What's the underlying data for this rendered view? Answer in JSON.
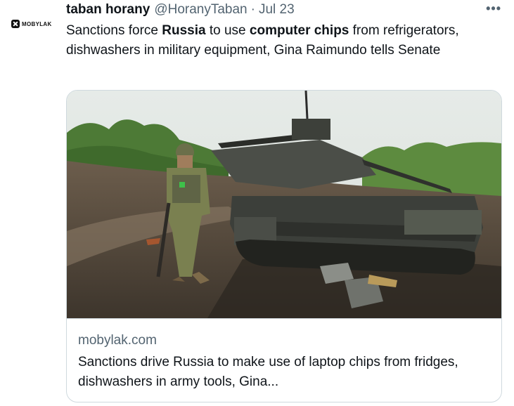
{
  "source_logo": {
    "text": "MOBYLAK",
    "icon": "mobylak-x-logo"
  },
  "tweet": {
    "display_name": "taban horany",
    "handle": "@HoranyTaban",
    "separator": "·",
    "date": "Jul 23",
    "more_icon": "more-horizontal-icon",
    "text_parts": {
      "p1": "Sanctions force ",
      "b1": "Russia",
      "p2": " to use ",
      "b2": "computer chips",
      "p3": " from refrigerators, dishwashers in military equipment, Gina Raimundo tells Senate"
    }
  },
  "card": {
    "image_alt": "Soldier walking past a destroyed tank on a muddy road",
    "domain": "mobylak.com",
    "title": "Sanctions drive Russia to make use of laptop chips from fridges, dishwashers in army tools, Gina..."
  },
  "colors": {
    "text": "#0f1419",
    "secondary": "#536471",
    "border": "#cfd9de"
  }
}
